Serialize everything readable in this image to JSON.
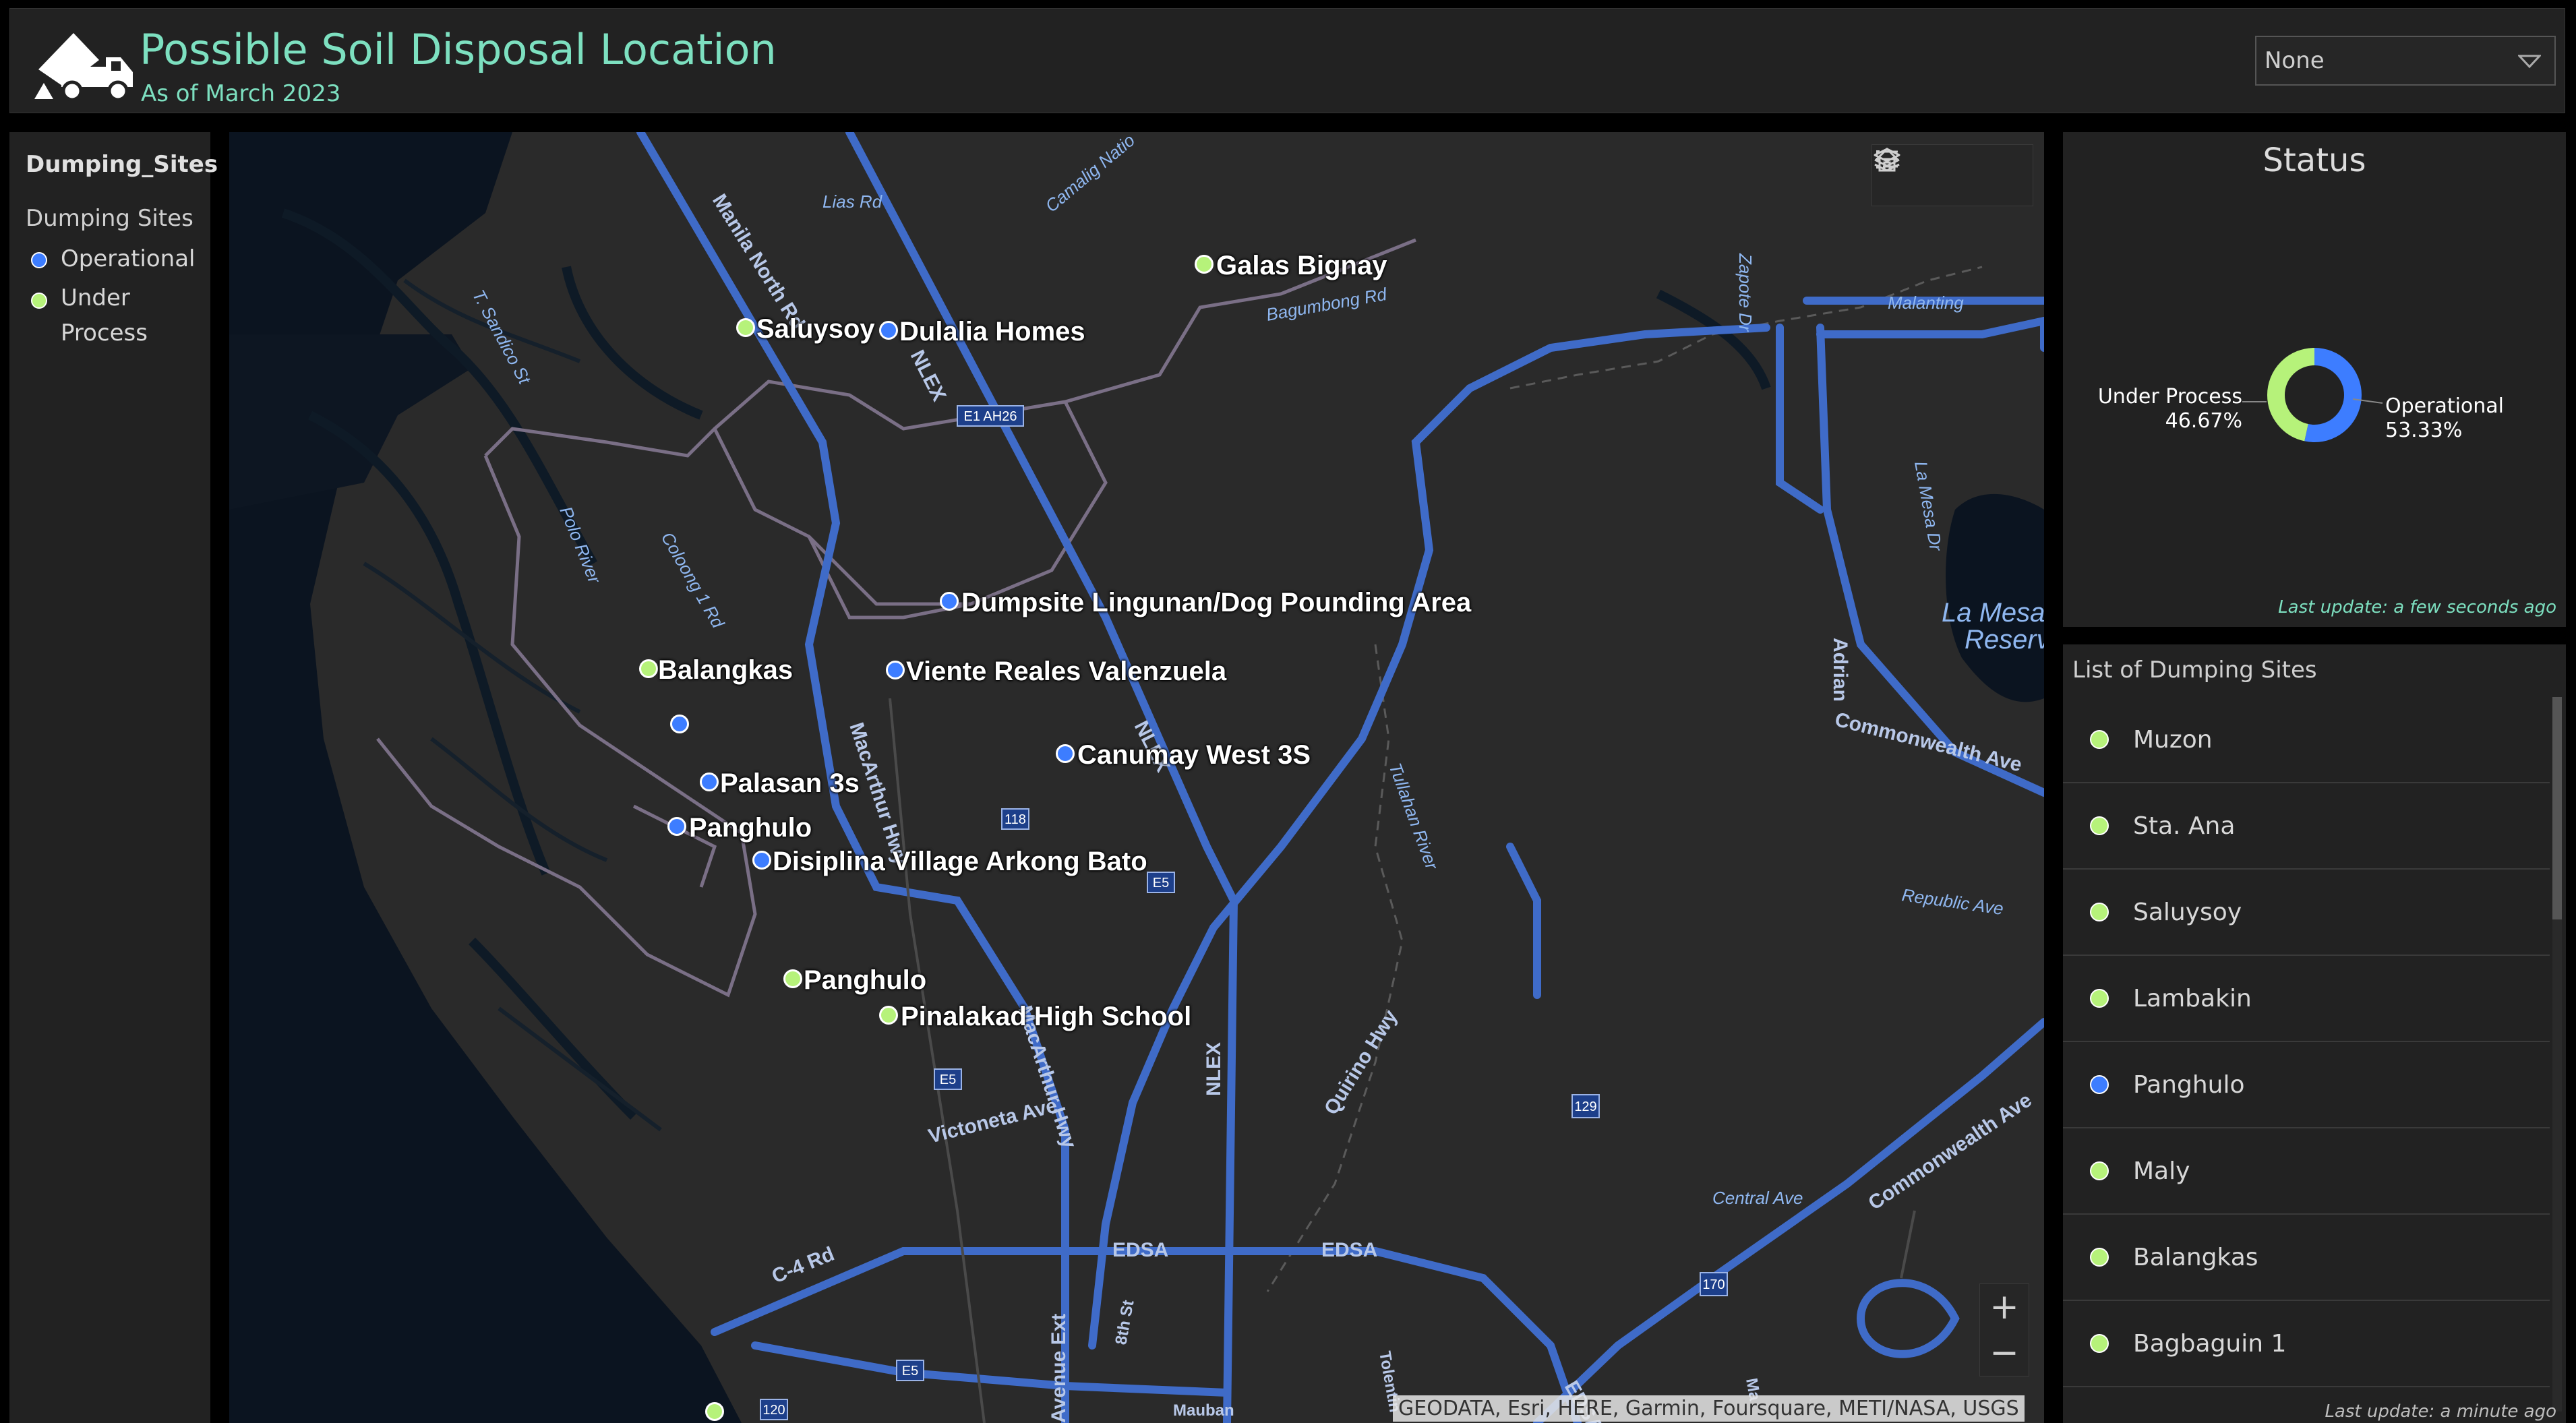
{
  "header": {
    "title": "Possible Soil Disposal Location",
    "subtitle": "As of March 2023",
    "selector_value": "None"
  },
  "legend": {
    "layer_name": "Dumping_Sites",
    "group_name": "Dumping Sites",
    "items": [
      {
        "label": "Operational",
        "color": "#3d7dff"
      },
      {
        "label": "Under Process",
        "color": "#b6f27a"
      }
    ]
  },
  "map": {
    "attribution": "GEODATA, Esri, HERE, Garmin, Foursquare, METI/NASA, USGS",
    "zoom_in_label": "+",
    "zoom_out_label": "−",
    "site_labels": [
      "Galas Bignay",
      "Saluysoy",
      "Dulalia  Homes",
      "Dumpsite Lingunan/Dog Pounding Area",
      "Balangkas",
      "Viente Reales Valenzuela",
      "Palasan 3s",
      "Canumay West 3S",
      "Panghulo",
      "Disiplina Village Arkong Bato",
      "Panghulo",
      "Pinalakad High School"
    ],
    "place_labels": {
      "manila_north_rd": "Manila North Rd",
      "nlex": "NLEX",
      "macarthur_hwy": "MacArthur Hwy",
      "polo_river": "Polo River",
      "coloong": "Coloong 1 Rd",
      "t_sandico": "T. Sandico St",
      "lias": "Lias Rd",
      "camalig": "Camalig Natio",
      "bagumbong": "Bagumbong Rd",
      "zapote": "Zapote Dr",
      "malanting": "Malanting",
      "la_mesa_dr": "La Mesa Dr",
      "la_mesa_res": "La Mesa D",
      "reservoir": "Reservoi",
      "adrian": "Adrian",
      "commonwealth": "Commonwealth Ave",
      "republic": "Republic Ave",
      "tullahan": "Tullahan River",
      "quirino": "Quirino Hwy",
      "victoneta": "Victoneta Ave",
      "central": "Central Ave",
      "edsa": "EDSA",
      "c4": "C-4 Rd",
      "avenue_ext": "Avenue Ext",
      "eighth": "8th St",
      "mauban": "Mauban",
      "e1": "E1 AH26",
      "s118": "118",
      "e5": "E5",
      "s129": "129",
      "s170": "170",
      "s120": "120",
      "tolentino": "Tolentin",
      "ma": "Ma"
    }
  },
  "status": {
    "title": "Status",
    "under_process_label": "Under Process",
    "under_process_pct": "46.67%",
    "operational_label": "Operational",
    "operational_pct": "53.33%",
    "last_update": "Last update: a few seconds ago",
    "values": {
      "operational": 53.33,
      "under_process": 46.67
    },
    "colors": {
      "operational": "#3d7dff",
      "under_process": "#b6f27a"
    }
  },
  "list": {
    "title": "List of Dumping Sites",
    "items": [
      {
        "name": "Muzon",
        "status": "under_process"
      },
      {
        "name": "Sta. Ana",
        "status": "under_process"
      },
      {
        "name": "Saluysoy",
        "status": "under_process"
      },
      {
        "name": "Lambakin",
        "status": "under_process"
      },
      {
        "name": "Panghulo",
        "status": "operational"
      },
      {
        "name": "Maly",
        "status": "under_process"
      },
      {
        "name": "Balangkas",
        "status": "under_process"
      },
      {
        "name": "Bagbaguin 1",
        "status": "under_process"
      }
    ],
    "last_update": "Last update: a minute ago"
  }
}
